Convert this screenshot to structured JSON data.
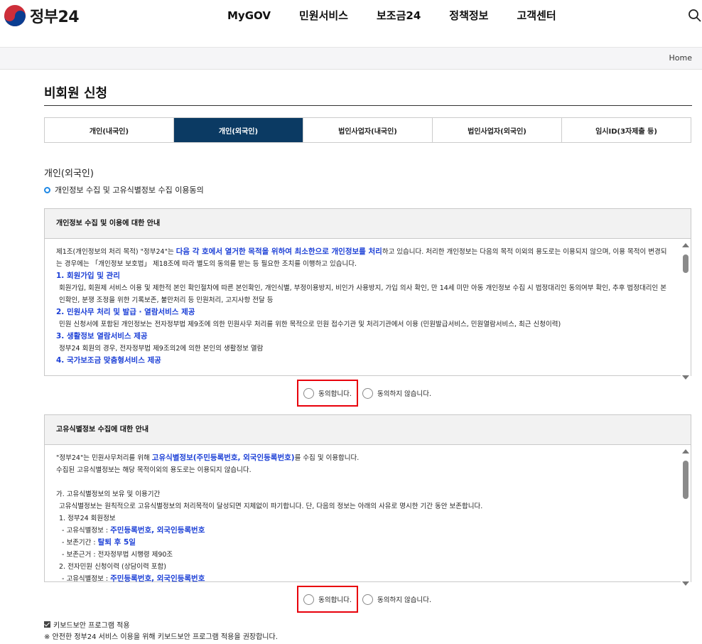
{
  "header": {
    "logo_text": "정부24",
    "nav": [
      "MyGOV",
      "민원서비스",
      "보조금24",
      "정책정보",
      "고객센터"
    ],
    "search_icon": "search-icon"
  },
  "breadcrumb": {
    "home": "Home"
  },
  "page": {
    "title": "비회원 신청"
  },
  "tabs": [
    {
      "label": "개인(내국인)",
      "active": false
    },
    {
      "label": "개인(외국인)",
      "active": true
    },
    {
      "label": "법인사업자(내국인)",
      "active": false
    },
    {
      "label": "법인사업자(외국인)",
      "active": false
    },
    {
      "label": "임시ID(3자제출 등)",
      "active": false
    }
  ],
  "section": {
    "title": "개인(외국인)",
    "subtitle": "개인정보 수집 및 고유식별정보 수집 이용동의"
  },
  "privacy_box": {
    "heading": "개인정보 수집 및 이용에 대한 안내",
    "p1_a": "제1조(개인정보의 처리 목적) \"정부24\"는 ",
    "p1_b": "다음 각 호에서 열거한 목적을 위하여 최소한으로 개인정보를 처리",
    "p1_c": "하고 있습니다. 처리한 개인정보는 다음의 목적 이외의 용도로는 이용되지 않으며, 이용 목적이 변경되는 경우에는 「개인정보 보호법」 제18조에 따라 별도의 동의를 받는 등 필요한 조치를 이행하고 있습니다.",
    "s1_title": "1. 회원가입 및 관리",
    "s1_body": "회원가입, 회원제 서비스 이용 및 제한적 본인 확인절차에 따른 본인확인, 개인식별, 부정이용방지, 비인가 사용방지, 가입 의사 확인, 만 14세 미만 아동 개인정보 수집 시 법정대리인 동의여부 확인, 추후 법정대리인 본인확인, 분쟁 조정을 위한 기록보존, 불만처리 등 민원처리, 고지사항 전달 등",
    "s2_title": "2. 민원사무 처리 및 발급 · 열람서비스 제공",
    "s2_body": "민원 신청서에 포함된 개인정보는 전자정부법 제9조에 의한 민원사무 처리를 위한 목적으로 민원 접수기관 및 처리기관에서 이용 (민원발급서비스, 민원열람서비스, 최근 신청이력)",
    "s3_title": "3. 생활정보 열람서비스 제공",
    "s3_body": "정부24 회원의 경우, 전자정부법 제9조의2에 의한 본인의 생활정보 열람",
    "s4_title": "4. 국가보조금 맞춤형서비스 제공"
  },
  "unique_box": {
    "heading": "고유식별정보 수집에 대한 안내",
    "p1_a": "\"정부24\"는 민원사무처리를 위해 ",
    "p1_b": "고유식별정보(주민등록번호, 외국인등록번호)",
    "p1_c": "를 수집 및 이용합니다.",
    "p2": "수집된 고유식별정보는 해당 목적이외의 용도로는 이용되지 않습니다.",
    "ga_title": "가. 고유식별정보의 보유 및 이용기간",
    "ga_body": "고유식별정보는 원칙적으로 고유식별정보의 처리목적이 달성되면 지체없이 파기합니다. 단, 다음의 정보는 아래의 사유로 명시한 기간 동안 보존합니다.",
    "item1": "1. 정부24 회원정보",
    "item1_a_label": "- 고유식별정보 : ",
    "item1_a_val": "주민등록번호, 외국인등록번호",
    "item1_b_label": "- 보존기간 : ",
    "item1_b_val": "탈퇴 후 5일",
    "item1_c": "- 보존근거 : 전자정부법 시행령 제90조",
    "item2": "2. 전자민원 신청이력 (상담이력 포함)",
    "item2_a_label": "- 고유식별정보 : ",
    "item2_a_val": "주민등록번호, 외국인등록번호"
  },
  "agree": {
    "yes": "동의합니다.",
    "no": "동의하지 않습니다."
  },
  "keyboard": {
    "label": "키보드보안 프로그램 적용",
    "note": "※ 안전한 정부24 서비스 이용을 위해 키보드보안 프로그램 적용을 권장합니다."
  }
}
